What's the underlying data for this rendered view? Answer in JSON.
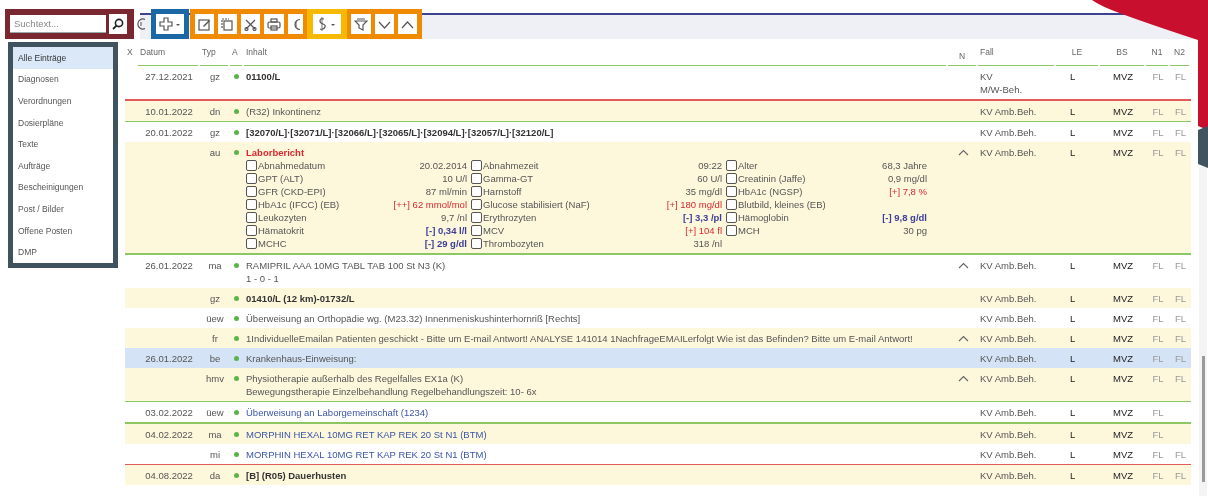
{
  "search": {
    "placeholder": "Suchtext..."
  },
  "sidebar": {
    "items": [
      {
        "label": "Alle Einträge",
        "selected": true
      },
      {
        "label": "Diagnosen",
        "selected": false
      },
      {
        "label": "Verordnungen",
        "selected": false
      },
      {
        "label": "Dosierpläne",
        "selected": false
      },
      {
        "label": "Texte",
        "selected": false
      },
      {
        "label": "Aufträge",
        "selected": false
      },
      {
        "label": "Bescheinigungen",
        "selected": false
      },
      {
        "label": "Post / Bilder",
        "selected": false
      },
      {
        "label": "Offene Posten",
        "selected": false
      },
      {
        "label": "DMP",
        "selected": false
      }
    ]
  },
  "table": {
    "columns": [
      "X",
      "Datum",
      "Typ",
      "A",
      "Inhalt",
      "N",
      "Fall",
      "LE",
      "BS",
      "N1",
      "N2"
    ],
    "rows": [
      {
        "date": "27.12.2021",
        "type": "gz",
        "content": "01100/L",
        "kind": "bold",
        "expanded": false,
        "fall": "KV\nM/W-Beh.",
        "le": "L",
        "bs": "MVZ",
        "n1": "FL",
        "n2": "FL",
        "selected": false
      },
      {
        "date": "10.01.2022",
        "type": "dn",
        "content": "(R32) Inkontinenz",
        "kind": "plain",
        "expanded": false,
        "fall": "KV Amb.Beh.",
        "le": "L",
        "bs": "MVZ",
        "n1": "FL",
        "n2": "FL",
        "selected": false,
        "color": "#e25a5a"
      },
      {
        "date": "20.01.2022",
        "type": "gz",
        "content": "[32070/L]·[32071/L]·[32066/L]·[32065/L]·[32094/L]·[32057/L]·[32120/L]",
        "kind": "bold",
        "expanded": false,
        "fall": "KV Amb.Beh.",
        "le": "L",
        "bs": "MVZ",
        "n1": "FL",
        "n2": "FL",
        "selected": false,
        "color": "#8cc665"
      },
      {
        "type": "au",
        "content": "Laborbericht",
        "kind": "alert",
        "expanded": true,
        "fall": "KV Amb.Beh.",
        "le": "L",
        "bs": "MVZ",
        "n1": "FL",
        "n2": "FL",
        "selected": false,
        "lab_results": [
          {
            "label": "Abnahmedatum",
            "value": "20.02.2014",
            "kind": "normal",
            "checked": false
          },
          {
            "label": "Abnahmezeit",
            "value": "09:22",
            "kind": "normal",
            "checked": false
          },
          {
            "label": "Alter",
            "value": "68,3 Jahre",
            "kind": "normal",
            "checked": false
          },
          {
            "label": "GPT (ALT)",
            "value": "10 U/l",
            "kind": "normal",
            "checked": false
          },
          {
            "label": "Gamma-GT",
            "value": "60 U/l",
            "kind": "normal",
            "checked": false
          },
          {
            "label": "Creatinin (Jaffe)",
            "value": "0,9 mg/dl",
            "kind": "normal",
            "checked": false
          },
          {
            "label": "GFR (CKD-EPI)",
            "value": "87 ml/min",
            "kind": "normal",
            "checked": false
          },
          {
            "label": "Harnstoff",
            "value": "35 mg/dl",
            "kind": "normal",
            "checked": false
          },
          {
            "label": "HbA1c (NGSP)",
            "value": "[+] 7,8 %",
            "kind": "high",
            "checked": false
          },
          {
            "label": "HbA1c (IFCC) (EB)",
            "value": "[++] 62 mmol/mol",
            "kind": "high",
            "checked": false
          },
          {
            "label": "Glucose stabilisiert (NaF)",
            "value": "[+] 180 mg/dl",
            "kind": "high",
            "checked": false
          },
          {
            "label": "Blutbild, kleines (EB)",
            "checked": false
          },
          {
            "label": "Leukozyten",
            "value": "9,7 /nl",
            "kind": "normal",
            "checked": false
          },
          {
            "label": "Erythrozyten",
            "value": "[-] 3,3 /pl",
            "kind": "low",
            "checked": false
          },
          {
            "label": "Hämoglobin",
            "value": "[-] 9,8 g/dl",
            "kind": "low",
            "checked": false
          },
          {
            "label": "Hämatokrit",
            "value": "[-] 0,34 l/l",
            "kind": "low",
            "checked": false
          },
          {
            "label": "MCV",
            "value": "[+] 104 fl",
            "kind": "high",
            "checked": false
          },
          {
            "label": "MCH",
            "value": "30 pg",
            "kind": "normal",
            "checked": false
          },
          {
            "label": "MCHC",
            "value": "[-] 29 g/dl",
            "kind": "low",
            "checked": false
          },
          {
            "label": "Thrombozyten",
            "value": "318 /nl",
            "kind": "normal",
            "checked": false
          }
        ]
      },
      {
        "date": "26.01.2022",
        "type": "ma",
        "content": "RAMIPRIL AAA 10MG TABL TAB 100 St N3 (K)\n1 - 0 - 1",
        "kind": "plain",
        "expanded": true,
        "fall": "KV Amb.Beh.",
        "le": "L",
        "bs": "MVZ",
        "n1": "FL",
        "n2": "FL",
        "selected": false,
        "color": "#8cc665"
      },
      {
        "type": "gz",
        "content": "01410/L (12 km)-01732/L",
        "kind": "bold",
        "expanded": false,
        "fall": "KV Amb.Beh.",
        "le": "L",
        "bs": "MVZ",
        "n1": "FL",
        "n2": "FL",
        "selected": false
      },
      {
        "type": "üew",
        "content": "Überweisung an Orthopädie wg. (M23.32) Innenmeniskushinterhornriß [Rechts]",
        "kind": "plain",
        "expanded": false,
        "fall": "KV Amb.Beh.",
        "le": "L",
        "bs": "MVZ",
        "n1": "FL",
        "n2": "FL",
        "selected": false
      },
      {
        "type": "fr",
        "content": "1IndividuelleEmailan Patienten geschickt - Bitte um E-mail Antwort! ANALYSE 141014 1NachfrageEMAILerfolgt Wie ist das Befinden? Bitte um E-mail Antwort!",
        "kind": "plain",
        "expanded": true,
        "fall": "KV Amb.Beh.",
        "le": "L",
        "bs": "MVZ",
        "n1": "FL",
        "n2": "FL",
        "selected": false
      },
      {
        "date": "26.01.2022",
        "type": "be",
        "content": "Krankenhaus-Einweisung:",
        "kind": "plain",
        "expanded": false,
        "fall": "KV Amb.Beh.",
        "le": "L",
        "bs": "MVZ",
        "n1": "FL",
        "n2": "FL",
        "selected": true
      },
      {
        "type": "hmv",
        "content": "Physiotherapie außerhalb des Regelfalles EX1a (K)\nBewegungstherapie Einzelbehandlung Regelbehandlungszeit: 10- 6x",
        "kind": "plain",
        "expanded": true,
        "fall": "KV Amb.Beh.",
        "le": "L",
        "bs": "MVZ",
        "n1": "FL",
        "n2": "FL",
        "selected": false
      },
      {
        "date": "03.02.2022",
        "type": "üew",
        "content": "Überweisung an Laborgemeinschaft (1234)",
        "kind": "link",
        "expanded": false,
        "fall": "KV Amb.Beh.",
        "le": "L",
        "bs": "MVZ",
        "n1": "FL",
        "selected": false,
        "color": "#8cc665"
      },
      {
        "date": "04.02.2022",
        "type": "ma",
        "content": "MORPHIN HEXAL 10MG RET KAP REK 20 St N1 (BTM)",
        "kind": "link",
        "expanded": false,
        "fall": "KV Amb.Beh.",
        "le": "L",
        "bs": "MVZ",
        "n1": "FL",
        "selected": false,
        "color": "#8cc665"
      },
      {
        "type": "mi",
        "content": "MORPHIN HEXAL 10MG RET KAP REK 20 St N1 (BTM)",
        "kind": "link",
        "expanded": false,
        "fall": "KV Amb.Beh.",
        "le": "L",
        "bs": "MVZ",
        "n1": "FL",
        "n2": "FL",
        "selected": false
      },
      {
        "date": "04.08.2022",
        "type": "da",
        "content": "[B] (R05) Dauerhusten",
        "kind": "bold",
        "expanded": false,
        "fall": "KV Amb.Beh.",
        "le": "L",
        "bs": "MVZ",
        "n1": "FL",
        "n2": "FL",
        "selected": false,
        "color": "#e25a5a"
      }
    ]
  }
}
